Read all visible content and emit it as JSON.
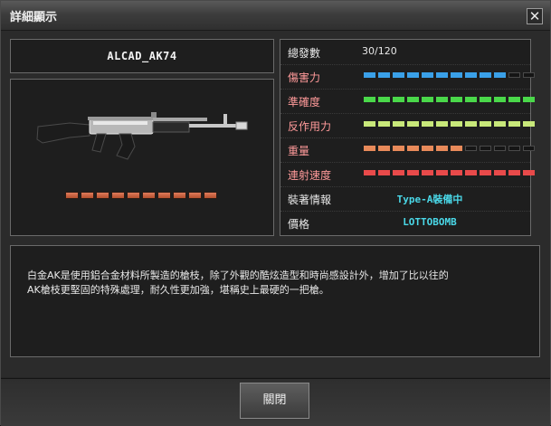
{
  "window": {
    "title": "詳細顯示",
    "close_glyph": "✕"
  },
  "weapon": {
    "name": "ALCAD_AK74",
    "durability": {
      "total": 10,
      "filled": 10,
      "color": "#e07a5a"
    }
  },
  "stats": {
    "ammo_label": "總發數",
    "ammo_value": "30/120",
    "bars": [
      {
        "label": "傷害力",
        "filled": 10,
        "total": 12,
        "color": "#3aa0e8"
      },
      {
        "label": "準確度",
        "filled": 12,
        "total": 12,
        "color": "#4ad84a"
      },
      {
        "label": "反作用力",
        "filled": 12,
        "total": 12,
        "color": "#c8e87a"
      },
      {
        "label": "重量",
        "filled": 7,
        "total": 12,
        "color": "#e88a5a"
      },
      {
        "label": "連射速度",
        "filled": 12,
        "total": 12,
        "color": "#e84a4a"
      }
    ],
    "equip_label": "裝著情報",
    "equip_value": "Type-A裝備中",
    "price_label": "價格",
    "price_value": "LOTTOBOMB"
  },
  "description": {
    "line1": "白金AK是使用鋁合金材料所製造的槍枝，除了外觀的酷炫造型和時尚感設計外，增加了比以往的",
    "line2": "AK槍枝更堅固的特殊處理，耐久性更加強，堪稱史上最硬的一把槍。"
  },
  "footer": {
    "close_label": "關閉"
  },
  "icons": [
    "close-icon",
    "rifle-icon"
  ]
}
